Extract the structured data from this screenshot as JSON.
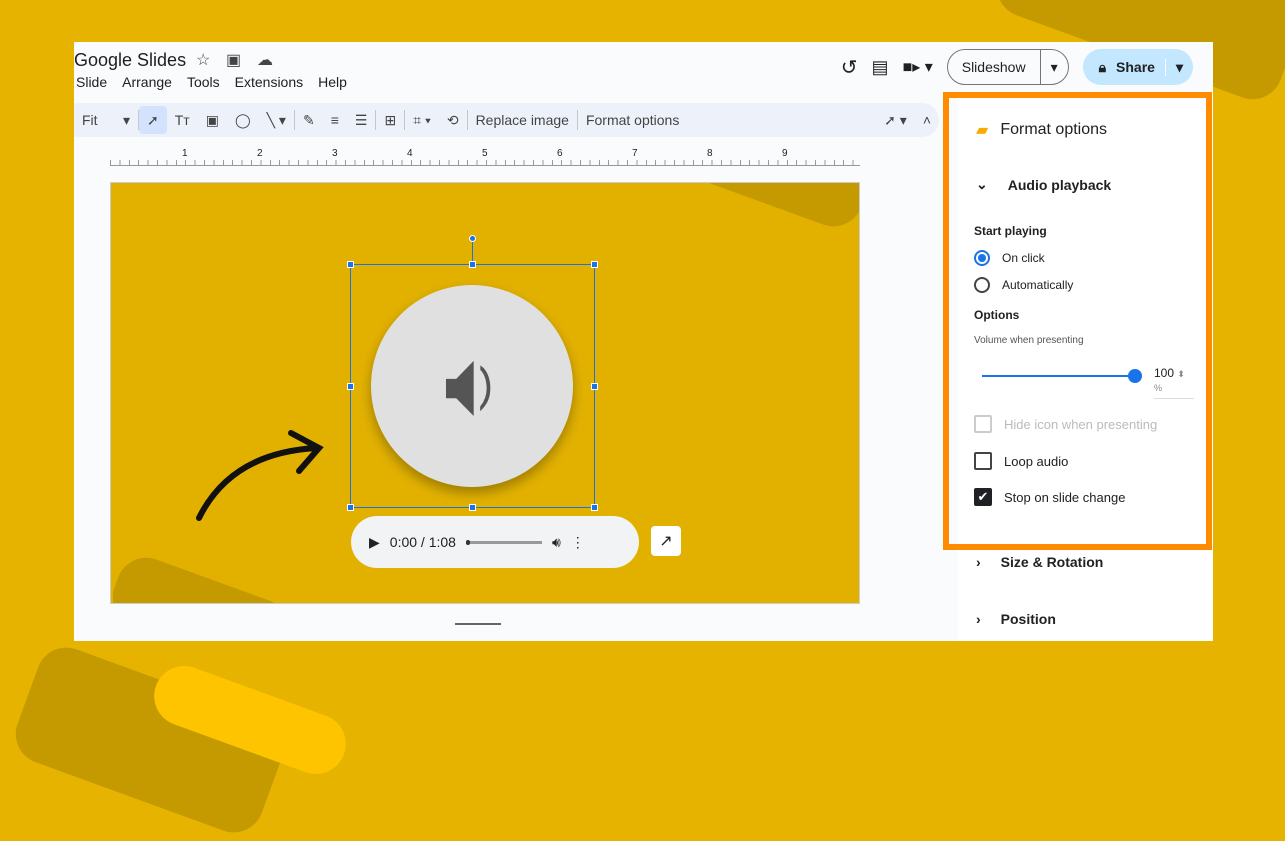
{
  "app": {
    "title": "Google Slides",
    "menu": [
      "Slide",
      "Arrange",
      "Tools",
      "Extensions",
      "Help"
    ]
  },
  "toolbar": {
    "zoom": "Fit",
    "replace_image": "Replace image",
    "format_options": "Format options"
  },
  "ruler": [
    "1",
    "2",
    "3",
    "4",
    "5",
    "6",
    "7",
    "8",
    "9"
  ],
  "header": {
    "slideshow": "Slideshow",
    "share": "Share"
  },
  "player": {
    "time": "0:00 / 1:08"
  },
  "panel": {
    "title": "Format options",
    "section": "Audio playback",
    "start_playing": "Start playing",
    "on_click": "On click",
    "automatically": "Automatically",
    "selected": "On click",
    "options": "Options",
    "volume_label": "Volume when presenting",
    "volume": "100",
    "volume_unit": "%",
    "hide_icon": "Hide icon when presenting",
    "hide_icon_checked": false,
    "loop": "Loop audio",
    "loop_checked": false,
    "stop": "Stop on slide change",
    "stop_checked": true,
    "size_rotation": "Size & Rotation",
    "position": "Position"
  },
  "colors": {
    "background": "#e6b400",
    "highlight": "#ff8c00",
    "accent": "#1a73e8"
  }
}
